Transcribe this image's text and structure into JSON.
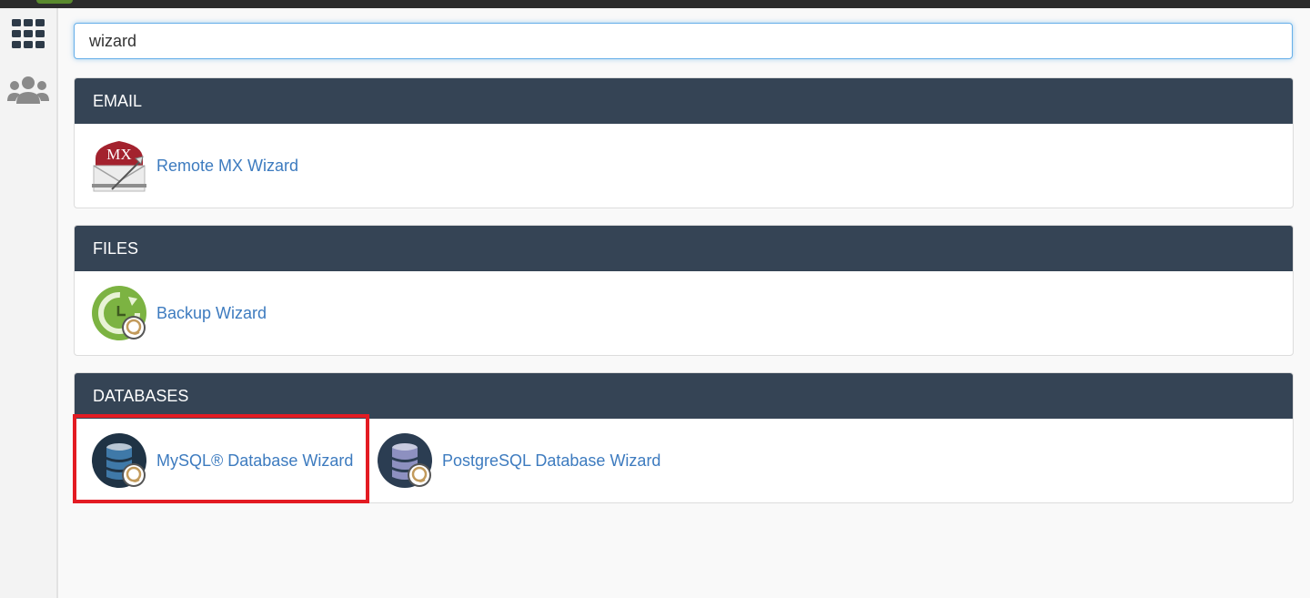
{
  "search": {
    "value": "wizard"
  },
  "sidebar": {
    "items": [
      {
        "icon": "grid-icon"
      },
      {
        "icon": "users-icon"
      }
    ]
  },
  "sections": [
    {
      "title": "EMAIL",
      "items": [
        {
          "label": "Remote MX Wizard",
          "icon": "mx-envelope-icon"
        }
      ]
    },
    {
      "title": "FILES",
      "items": [
        {
          "label": "Backup Wizard",
          "icon": "backup-clock-icon"
        }
      ]
    },
    {
      "title": "DATABASES",
      "items": [
        {
          "label": "MySQL® Database Wizard",
          "icon": "mysql-database-icon"
        },
        {
          "label": "PostgreSQL Database Wizard",
          "icon": "postgresql-database-icon"
        }
      ]
    }
  ],
  "colors": {
    "panel_header": "#354455",
    "link": "#3d7bbf",
    "highlight": "#e31b23",
    "accent_green": "#7cb342"
  }
}
